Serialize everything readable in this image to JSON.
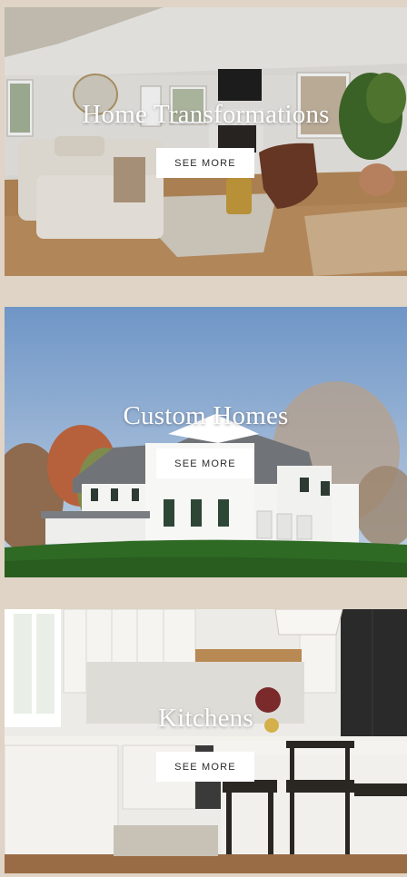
{
  "cards": [
    {
      "title": "Home Transformations",
      "button_label": "SEE MORE"
    },
    {
      "title": "Custom Homes",
      "button_label": "SEE MORE"
    },
    {
      "title": "Kitchens",
      "button_label": "SEE MORE"
    }
  ],
  "colors": {
    "page_background": "#dfd4c5",
    "button_background": "#ffffff",
    "button_text": "#2a2a2a",
    "title_text": "#ffffff"
  }
}
